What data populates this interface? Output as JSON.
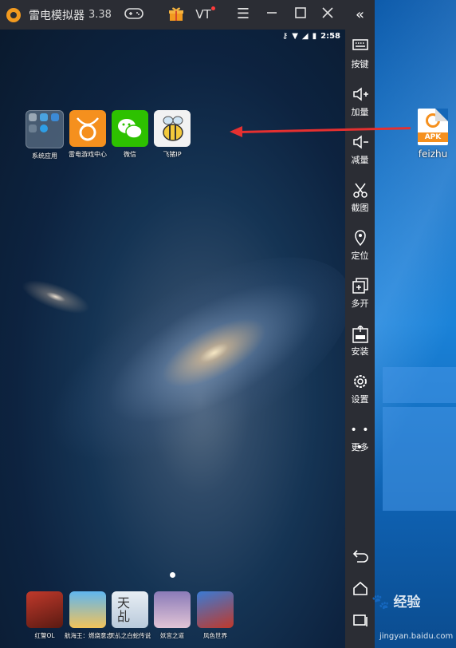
{
  "window": {
    "title": "雷电模拟器",
    "version": "3.38",
    "vt_label": "VT"
  },
  "statusbar": {
    "time": "2:58"
  },
  "home_apps": [
    {
      "label": "系统应用"
    },
    {
      "label": "雷电游戏中心"
    },
    {
      "label": "微信"
    },
    {
      "label": "飞猪IP"
    }
  ],
  "dock_apps": [
    {
      "label": "红警OL"
    },
    {
      "label": "航海王：燃烧意志"
    },
    {
      "label": "天乩之白蛇传说"
    },
    {
      "label": "妖宫之道"
    },
    {
      "label": "风色世界"
    }
  ],
  "dock_tiankai_text": "天乩",
  "sidebar": {
    "items": [
      {
        "label": "按键",
        "icon": "keyboard-icon"
      },
      {
        "label": "加量",
        "icon": "volume-up-icon"
      },
      {
        "label": "减量",
        "icon": "volume-down-icon"
      },
      {
        "label": "截图",
        "icon": "scissors-icon"
      },
      {
        "label": "定位",
        "icon": "location-icon"
      },
      {
        "label": "多开",
        "icon": "multi-instance-icon"
      },
      {
        "label": "安装",
        "icon": "apk-install-icon"
      },
      {
        "label": "设置",
        "icon": "settings-icon"
      },
      {
        "label": "更多",
        "icon": "more-icon"
      }
    ]
  },
  "desktop_file": {
    "name": "feizhu",
    "badge": "APK"
  },
  "watermark": {
    "brand": "经验",
    "url": "jingyan.baidu.com"
  },
  "colors": {
    "accent_orange": "#f5901e",
    "wechat_green": "#2dc100",
    "arrow_red": "#e53030"
  }
}
